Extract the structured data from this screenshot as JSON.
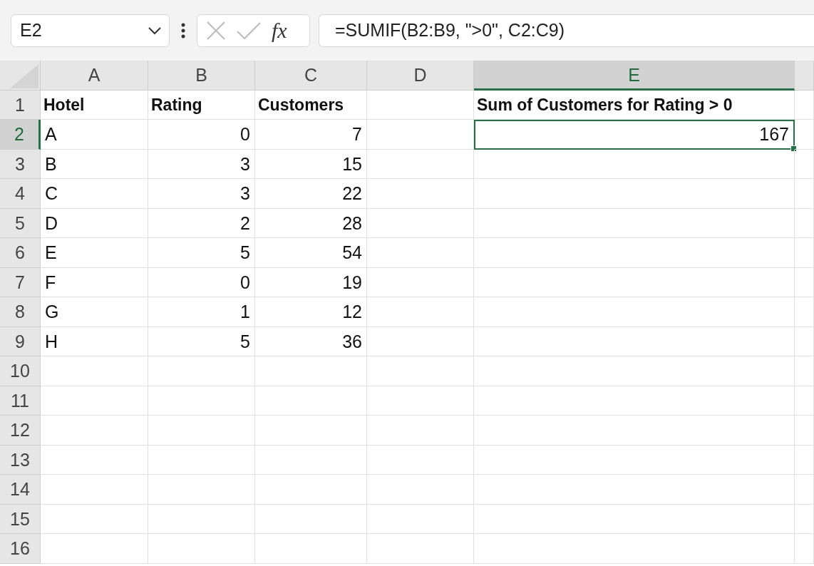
{
  "name_box": {
    "value": "E2"
  },
  "formula_bar": {
    "function_label": "fx",
    "formula": "=SUMIF(B2:B9, \">0\", C2:C9)"
  },
  "columns": [
    {
      "label": "A",
      "selected": false
    },
    {
      "label": "B",
      "selected": false
    },
    {
      "label": "C",
      "selected": false
    },
    {
      "label": "D",
      "selected": false
    },
    {
      "label": "E",
      "selected": true
    }
  ],
  "rows": [
    {
      "label": "1",
      "selected": false,
      "cells": [
        {
          "kind": "header",
          "text": "Hotel",
          "selected": false
        },
        {
          "kind": "header",
          "text": "Rating",
          "selected": false
        },
        {
          "kind": "header",
          "text": "Customers",
          "selected": false
        },
        {
          "kind": "empty",
          "selected": false
        },
        {
          "kind": "header",
          "text": "Sum of Customers for Rating > 0",
          "selected": false
        }
      ]
    },
    {
      "label": "2",
      "selected": true,
      "cells": [
        {
          "kind": "text",
          "text": "A",
          "selected": false
        },
        {
          "kind": "number",
          "text": "0",
          "selected": false
        },
        {
          "kind": "number",
          "text": "7",
          "selected": false
        },
        {
          "kind": "empty",
          "selected": false
        },
        {
          "kind": "number",
          "text": "167",
          "selected": true
        }
      ]
    },
    {
      "label": "3",
      "selected": false,
      "cells": [
        {
          "kind": "text",
          "text": "B",
          "selected": false
        },
        {
          "kind": "number",
          "text": "3",
          "selected": false
        },
        {
          "kind": "number",
          "text": "15",
          "selected": false
        },
        {
          "kind": "empty",
          "selected": false
        },
        {
          "kind": "empty",
          "selected": false
        }
      ]
    },
    {
      "label": "4",
      "selected": false,
      "cells": [
        {
          "kind": "text",
          "text": "C",
          "selected": false
        },
        {
          "kind": "number",
          "text": "3",
          "selected": false
        },
        {
          "kind": "number",
          "text": "22",
          "selected": false
        },
        {
          "kind": "empty",
          "selected": false
        },
        {
          "kind": "empty",
          "selected": false
        }
      ]
    },
    {
      "label": "5",
      "selected": false,
      "cells": [
        {
          "kind": "text",
          "text": "D",
          "selected": false
        },
        {
          "kind": "number",
          "text": "2",
          "selected": false
        },
        {
          "kind": "number",
          "text": "28",
          "selected": false
        },
        {
          "kind": "empty",
          "selected": false
        },
        {
          "kind": "empty",
          "selected": false
        }
      ]
    },
    {
      "label": "6",
      "selected": false,
      "cells": [
        {
          "kind": "text",
          "text": "E",
          "selected": false
        },
        {
          "kind": "number",
          "text": "5",
          "selected": false
        },
        {
          "kind": "number",
          "text": "54",
          "selected": false
        },
        {
          "kind": "empty",
          "selected": false
        },
        {
          "kind": "empty",
          "selected": false
        }
      ]
    },
    {
      "label": "7",
      "selected": false,
      "cells": [
        {
          "kind": "text",
          "text": "F",
          "selected": false
        },
        {
          "kind": "number",
          "text": "0",
          "selected": false
        },
        {
          "kind": "number",
          "text": "19",
          "selected": false
        },
        {
          "kind": "empty",
          "selected": false
        },
        {
          "kind": "empty",
          "selected": false
        }
      ]
    },
    {
      "label": "8",
      "selected": false,
      "cells": [
        {
          "kind": "text",
          "text": "G",
          "selected": false
        },
        {
          "kind": "number",
          "text": "1",
          "selected": false
        },
        {
          "kind": "number",
          "text": "12",
          "selected": false
        },
        {
          "kind": "empty",
          "selected": false
        },
        {
          "kind": "empty",
          "selected": false
        }
      ]
    },
    {
      "label": "9",
      "selected": false,
      "cells": [
        {
          "kind": "text",
          "text": "H",
          "selected": false
        },
        {
          "kind": "number",
          "text": "5",
          "selected": false
        },
        {
          "kind": "number",
          "text": "36",
          "selected": false
        },
        {
          "kind": "empty",
          "selected": false
        },
        {
          "kind": "empty",
          "selected": false
        }
      ]
    },
    {
      "label": "10",
      "selected": false
    },
    {
      "label": "11",
      "selected": false
    },
    {
      "label": "12",
      "selected": false
    },
    {
      "label": "13",
      "selected": false
    },
    {
      "label": "14",
      "selected": false
    },
    {
      "label": "15",
      "selected": false
    },
    {
      "label": "16",
      "selected": false
    }
  ]
}
